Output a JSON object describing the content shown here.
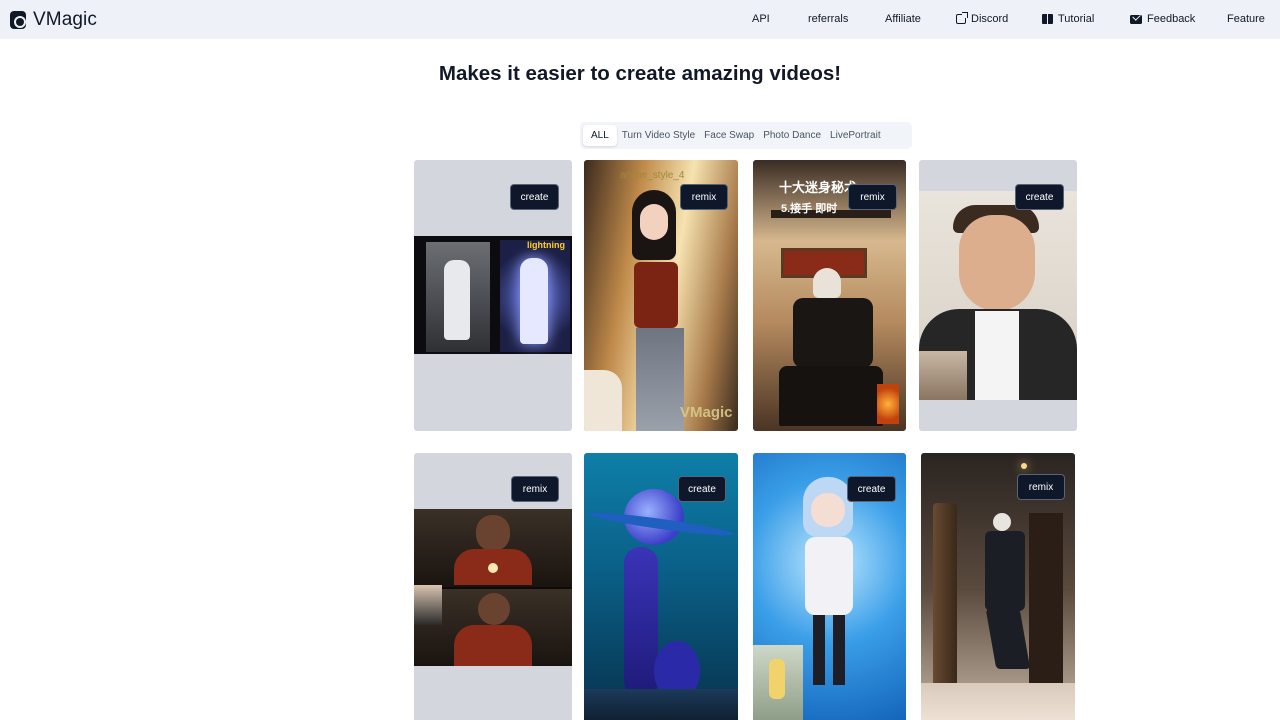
{
  "header": {
    "brand": "VMagic",
    "nav": [
      {
        "label": "API"
      },
      {
        "label": "referrals"
      },
      {
        "label": "Affiliate"
      },
      {
        "label": "Discord",
        "icon": "external-link-icon"
      },
      {
        "label": "Tutorial",
        "icon": "book-icon"
      },
      {
        "label": "Feedback",
        "icon": "mail-icon"
      },
      {
        "label": "Feature"
      }
    ]
  },
  "hero": {
    "title": "Makes it easier to create amazing videos!"
  },
  "tabs": [
    {
      "label": "ALL",
      "active": true
    },
    {
      "label": "Turn Video Style"
    },
    {
      "label": "Face Swap"
    },
    {
      "label": "Photo Dance"
    },
    {
      "label": "LivePortrait"
    }
  ],
  "cards": [
    {
      "action": "create",
      "overlay": "lightning"
    },
    {
      "action": "remix",
      "overlay": "anime_style_4",
      "watermark": "VMagic"
    },
    {
      "action": "remix",
      "overlay": "十大迷身秘术",
      "overlay2": "5.接手 即时"
    },
    {
      "action": "create"
    },
    {
      "action": "remix"
    },
    {
      "action": "create"
    },
    {
      "action": "create"
    },
    {
      "action": "remix"
    }
  ],
  "colors": {
    "header_bg": "#eef1f7",
    "button_bg": "#0f172a",
    "card_bg": "#d3d6dd"
  }
}
